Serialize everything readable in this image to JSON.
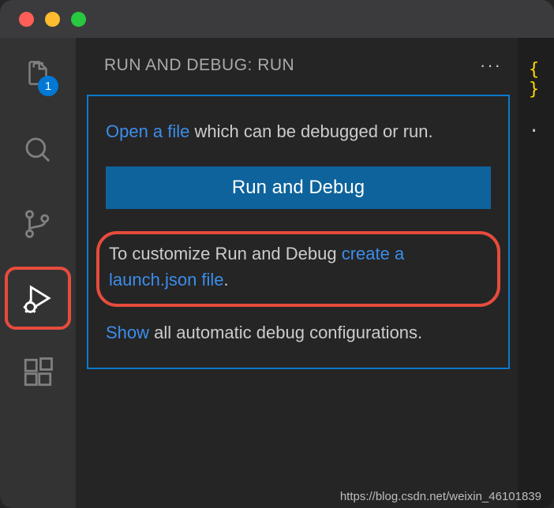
{
  "traffic": {
    "close": "close",
    "min": "minimize",
    "max": "maximize"
  },
  "activity": {
    "explorer_badge": "1"
  },
  "panel": {
    "title": "RUN AND DEBUG: RUN",
    "more": "···"
  },
  "content": {
    "open_link": "Open a file",
    "open_rest": " which can be debugged or run.",
    "button": "Run and Debug",
    "customize_pre": "To customize Run and Debug ",
    "customize_link": "create a launch.json file",
    "customize_post": ".",
    "show_link": "Show",
    "show_rest": " all automatic debug configurations."
  },
  "editor_peek": {
    "brace": "{ }",
    "dot": "."
  },
  "watermark": "https://blog.csdn.net/weixin_46101839"
}
